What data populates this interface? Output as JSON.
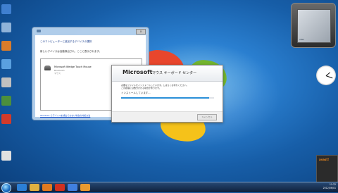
{
  "desktop": {
    "icons": [
      {
        "label": "",
        "color": "#3f7fd0"
      },
      {
        "label": "",
        "color": "#8fb3d9"
      },
      {
        "label": "",
        "color": "#d97c2b"
      },
      {
        "label": "",
        "color": "#5aa0e0"
      },
      {
        "label": "",
        "color": "#c0c0c0"
      },
      {
        "label": "",
        "color": "#4c8f3c"
      },
      {
        "label": "",
        "color": "#d23a2a"
      },
      {
        "label": "",
        "color": "#e0e0e0"
      }
    ]
  },
  "dialog_pairing": {
    "heading": "このコンピューターに追加するデバイスの選択",
    "subheading": "新しいデバイスは自動検出され、ここに表示されます。",
    "device": {
      "name": "Microsoft Wedge Touch Mouse",
      "status": "Bluetooth",
      "kind": "マウス"
    },
    "link": "Windows でデバイスを検出できない場合の対処方法",
    "close_label": "x"
  },
  "dialog_installer": {
    "brand": "Microsoft",
    "title": "マウス キーボード センター",
    "message_line1": "必要なファイルをインストールしています。しばらくお待ちください。",
    "message_line2": "この処理には数分かかる場合があります。",
    "status": "インストールしています...",
    "progress": 0.95,
    "cancel_label": "キャンセル"
  },
  "gadgets": {
    "cpu_label": "intel"
  },
  "notification": {
    "brand": "avast!",
    "text": ""
  },
  "taskbar": {
    "time": "11:22",
    "date": "2012/06/01",
    "buttons": [
      {
        "name": "ie",
        "color": "#2b7fd6"
      },
      {
        "name": "explorer",
        "color": "#e0b040"
      },
      {
        "name": "media",
        "color": "#e07a20"
      },
      {
        "name": "app-red",
        "color": "#d03020"
      },
      {
        "name": "app-blue",
        "color": "#4080e0"
      },
      {
        "name": "app-orange",
        "color": "#e89a30"
      }
    ]
  }
}
